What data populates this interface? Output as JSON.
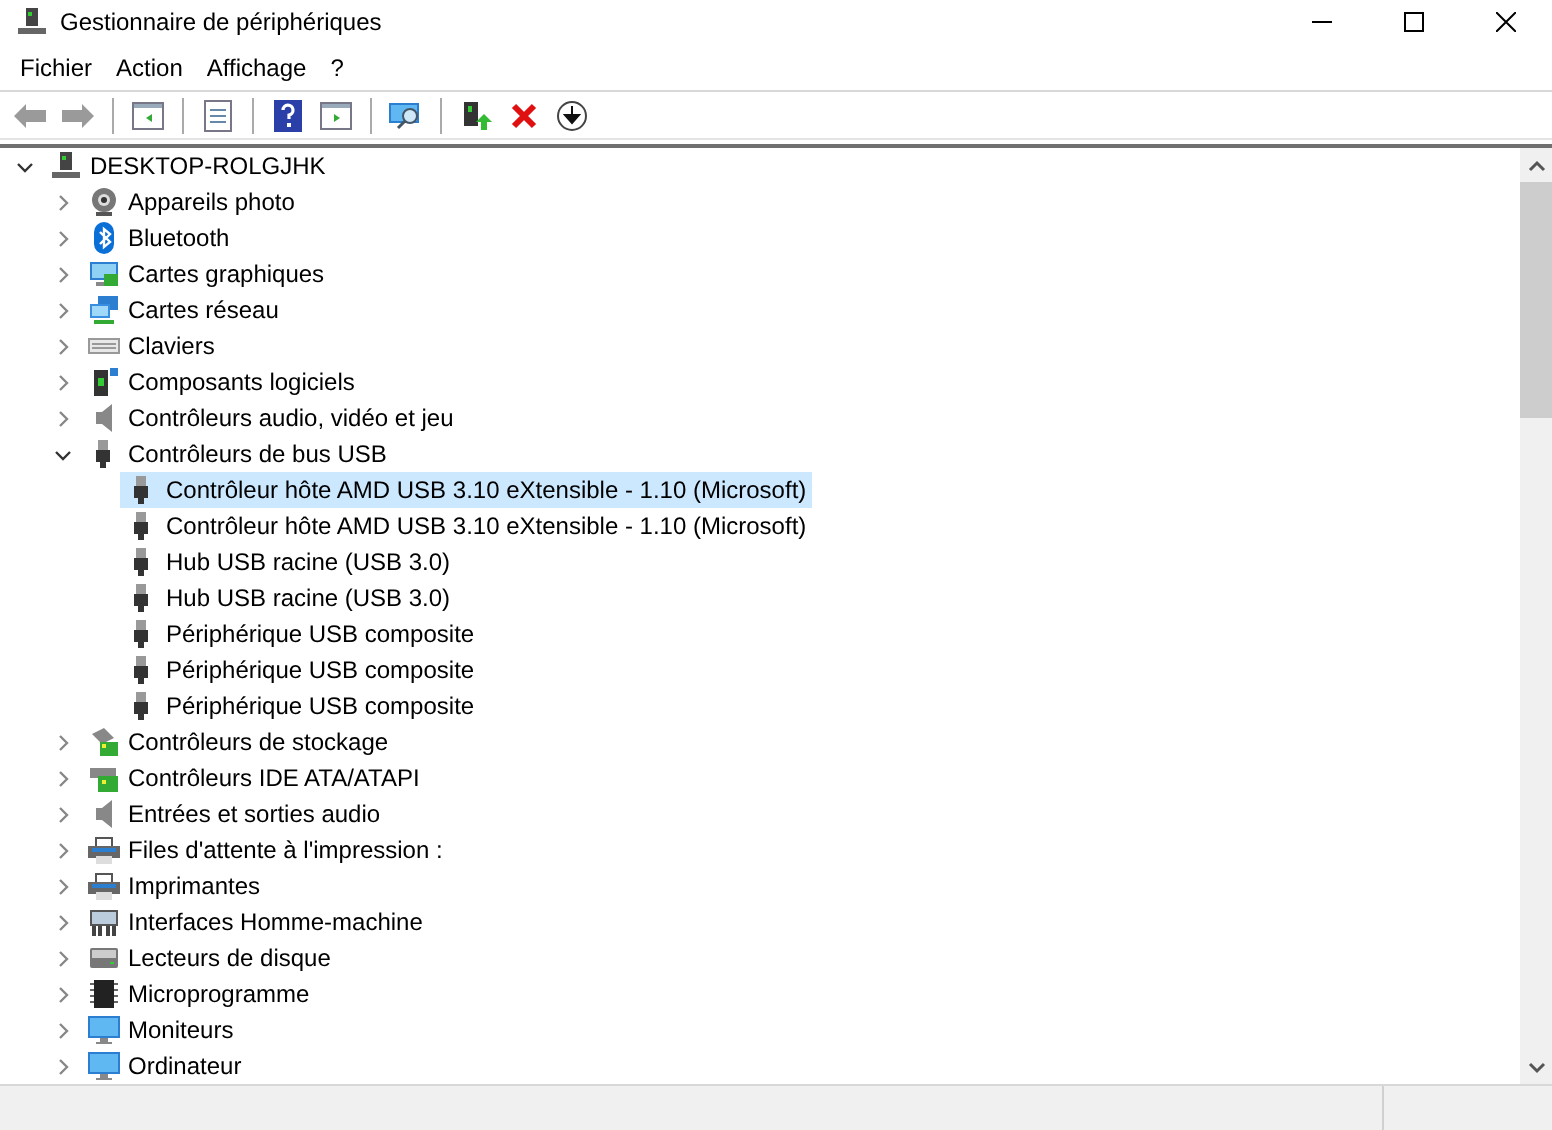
{
  "window": {
    "title": "Gestionnaire de périphériques"
  },
  "menu": [
    "Fichier",
    "Action",
    "Affichage",
    "?"
  ],
  "tree": [
    {
      "label": "DESKTOP-ROLGJHK",
      "expanded": true,
      "selected": false,
      "children": [
        {
          "label": "Appareils photo",
          "expanded": false,
          "selected": false
        },
        {
          "label": "Bluetooth",
          "expanded": false,
          "selected": false
        },
        {
          "label": "Cartes graphiques",
          "expanded": false,
          "selected": false
        },
        {
          "label": "Cartes réseau",
          "expanded": false,
          "selected": false
        },
        {
          "label": "Claviers",
          "expanded": false,
          "selected": false
        },
        {
          "label": "Composants logiciels",
          "expanded": false,
          "selected": false
        },
        {
          "label": "Contrôleurs audio, vidéo et jeu",
          "expanded": false,
          "selected": false
        },
        {
          "label": "Contrôleurs de bus USB",
          "expanded": true,
          "selected": false,
          "children": [
            {
              "label": "Contrôleur hôte AMD USB 3.10 eXtensible - 1.10 (Microsoft)",
              "selected": true
            },
            {
              "label": "Contrôleur hôte AMD USB 3.10 eXtensible - 1.10 (Microsoft)",
              "selected": false
            },
            {
              "label": "Hub USB racine (USB 3.0)",
              "selected": false
            },
            {
              "label": "Hub USB racine (USB 3.0)",
              "selected": false
            },
            {
              "label": "Périphérique USB composite",
              "selected": false
            },
            {
              "label": "Périphérique USB composite",
              "selected": false
            },
            {
              "label": "Périphérique USB composite",
              "selected": false
            }
          ]
        },
        {
          "label": "Contrôleurs de stockage",
          "expanded": false,
          "selected": false
        },
        {
          "label": "Contrôleurs IDE ATA/ATAPI",
          "expanded": false,
          "selected": false
        },
        {
          "label": "Entrées et sorties audio",
          "expanded": false,
          "selected": false
        },
        {
          "label": "Files d'attente à l'impression :",
          "expanded": false,
          "selected": false
        },
        {
          "label": "Imprimantes",
          "expanded": false,
          "selected": false
        },
        {
          "label": "Interfaces Homme-machine",
          "expanded": false,
          "selected": false
        },
        {
          "label": "Lecteurs de disque",
          "expanded": false,
          "selected": false
        },
        {
          "label": "Microprogramme",
          "expanded": false,
          "selected": false
        },
        {
          "label": "Moniteurs",
          "expanded": false,
          "selected": false
        },
        {
          "label": "Ordinateur",
          "expanded": false,
          "selected": false
        }
      ]
    }
  ]
}
